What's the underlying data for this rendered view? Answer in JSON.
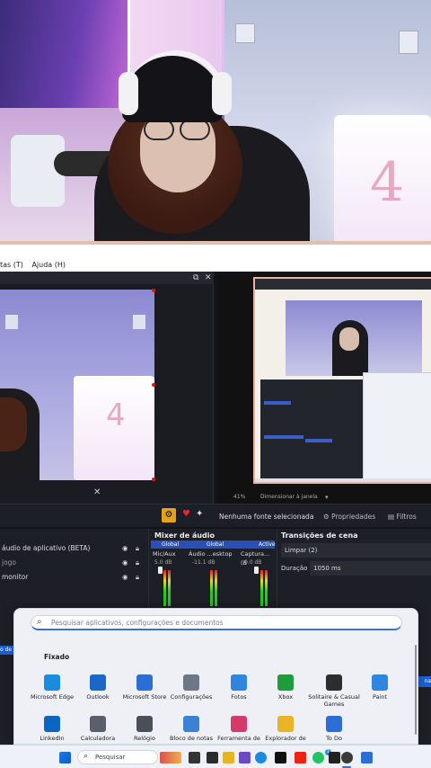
{
  "colors": {
    "obs_bg": "#1d1f26",
    "obs_accent": "#2a4fb8",
    "start_bg": "#eef0f6",
    "taskbar_bg": "#eef1f7",
    "record_gear": "#e3a31a"
  },
  "obs": {
    "menubar": [
      "tas (T)",
      "Ajuda (H)"
    ],
    "toolbar": {
      "settings_icon": "gear-icon",
      "no_source_label": "Nenhuma fonte selecionada",
      "properties_label": "Propriedades",
      "filters_label": "Filtros"
    },
    "program_footer": {
      "zoom": "41%",
      "fit_label": "Dimensionar à janela"
    },
    "sources": [
      {
        "label": "áudio de aplicativo (BETA)"
      },
      {
        "label": "jogo"
      },
      {
        "label": "monitor"
      }
    ],
    "mixer": {
      "title": "Mixer de áudio",
      "header_labels": [
        "Global",
        "Global",
        "Active"
      ],
      "channel_names": [
        "Mic/Aux",
        "Áudio ...esktop",
        "Captura... (B"
      ],
      "db_values": [
        "5.0 dB",
        "-11.1 dB",
        "0.0 dB"
      ]
    },
    "transitions": {
      "title": "Transições de cena",
      "selected": "Limpar (2)",
      "duration_label": "Duração",
      "duration_value": "1050 ms"
    }
  },
  "start_menu": {
    "search_placeholder": "Pesquisar aplicativos, configurações e documentos",
    "pinned_title": "Fixado",
    "apps_row1": [
      {
        "label": "Microsoft Edge",
        "icon": "edge-icon",
        "color": "#1b8be0"
      },
      {
        "label": "Outlook",
        "icon": "outlook-icon",
        "color": "#1a66c9"
      },
      {
        "label": "Microsoft Store",
        "icon": "store-icon",
        "color": "#2b6fd6"
      },
      {
        "label": "Configurações",
        "icon": "settings-icon",
        "color": "#6d7788"
      },
      {
        "label": "Fotos",
        "icon": "photos-icon",
        "color": "#2f86e0"
      },
      {
        "label": "Xbox",
        "icon": "xbox-icon",
        "color": "#1f9d3a"
      },
      {
        "label": "Solitaire & Casual Games",
        "icon": "solitaire-icon",
        "color": "#2d2d2d"
      },
      {
        "label": "Paint",
        "icon": "paint-icon",
        "color": "#2f86e0"
      }
    ],
    "apps_row2": [
      {
        "label": "LinkedIn",
        "icon": "linkedin-icon",
        "color": "#0a66c2"
      },
      {
        "label": "Calculadora",
        "icon": "calculator-icon",
        "color": "#5a5f6b"
      },
      {
        "label": "Relógio",
        "icon": "clock-icon",
        "color": "#4a4f5a"
      },
      {
        "label": "Bloco de notas",
        "icon": "notepad-icon",
        "color": "#3b82d6"
      },
      {
        "label": "Ferramenta de",
        "icon": "snipping-tool-icon",
        "color": "#d63a6a"
      },
      {
        "label": "Explorador de",
        "icon": "file-explorer-icon",
        "color": "#e8b324"
      },
      {
        "label": "To Do",
        "icon": "todo-icon",
        "color": "#2b6fd6"
      }
    ]
  },
  "taskbar": {
    "search_label": "Pesquisar",
    "notification_badge": "1"
  }
}
